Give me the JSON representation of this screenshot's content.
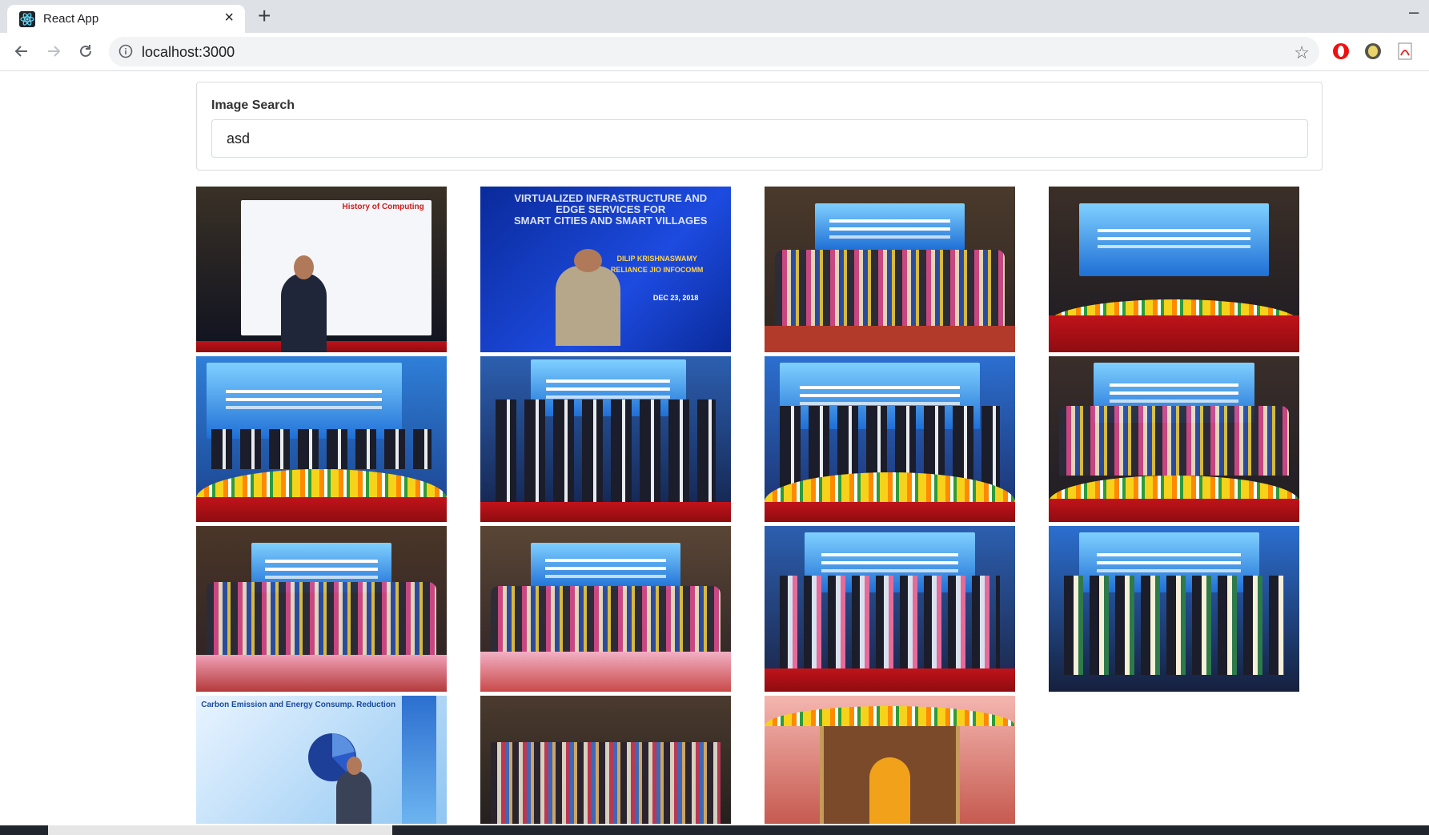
{
  "browser": {
    "tab_title": "React App",
    "tab_close": "×",
    "new_tab": "+",
    "minimize": "–",
    "url": "localhost:3000"
  },
  "page": {
    "search": {
      "label": "Image Search",
      "value": "asd"
    }
  }
}
